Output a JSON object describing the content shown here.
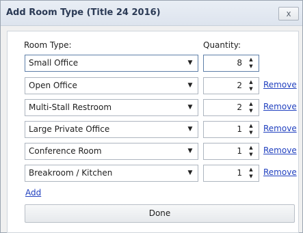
{
  "window": {
    "title": "Add Room Type (Title 24 2016)",
    "close_glyph": "x"
  },
  "headers": {
    "room_type": "Room Type:",
    "quantity": "Quantity:"
  },
  "rows": [
    {
      "room_type": "Small Office",
      "quantity": "8",
      "remove": ""
    },
    {
      "room_type": "Open Office",
      "quantity": "2",
      "remove": "Remove"
    },
    {
      "room_type": "Multi-Stall Restroom",
      "quantity": "2",
      "remove": "Remove"
    },
    {
      "room_type": "Large Private Office",
      "quantity": "1",
      "remove": "Remove"
    },
    {
      "room_type": "Conference Room",
      "quantity": "1",
      "remove": "Remove"
    },
    {
      "room_type": "Breakroom / Kitchen",
      "quantity": "1",
      "remove": "Remove"
    }
  ],
  "actions": {
    "add": "Add",
    "done": "Done"
  },
  "icons": {
    "dropdown": "chevron-down-icon",
    "spin_up": "spin-up-icon",
    "spin_down": "spin-down-icon",
    "close": "close-icon"
  },
  "colors": {
    "link": "#1f3fbf",
    "title_text": "#2b3a55",
    "focus_border": "#5d7ea8"
  }
}
